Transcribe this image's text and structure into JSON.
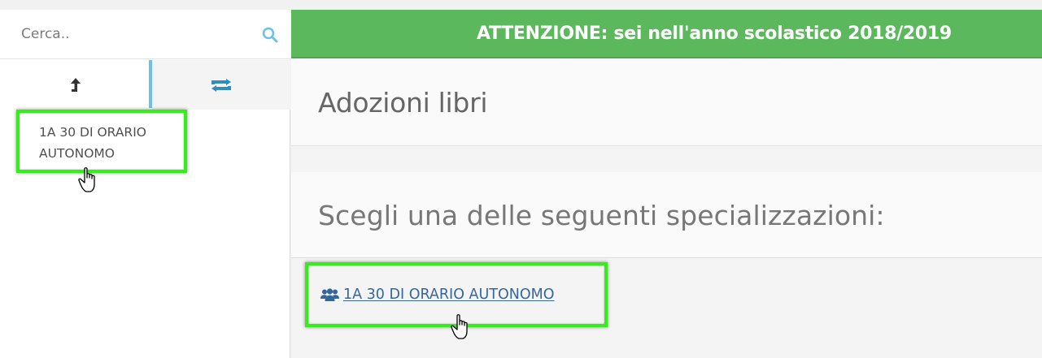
{
  "search": {
    "placeholder": "Cerca.."
  },
  "sidebar": {
    "tabs": [
      {
        "icon": "level-up-arrow-icon"
      },
      {
        "icon": "refresh-retweet-icon",
        "active": true
      }
    ],
    "tree_item": {
      "line1": "1A 30 DI ORARIO",
      "line2": "AUTONOMO"
    }
  },
  "banner": {
    "text": "ATTENZIONE: sei nell'anno scolastico 2018/2019"
  },
  "main": {
    "title": "Adozioni libri",
    "choose_heading": "Scegli una delle seguenti specializzazioni:",
    "specializations": [
      {
        "icon": "group-users-icon",
        "label": "1A 30 DI ORARIO AUTONOMO"
      }
    ]
  },
  "colors": {
    "banner_bg": "#5cb85c",
    "highlight_border": "#33ee1a",
    "link": "#35669a",
    "accent_blue": "#6ec0e6"
  }
}
